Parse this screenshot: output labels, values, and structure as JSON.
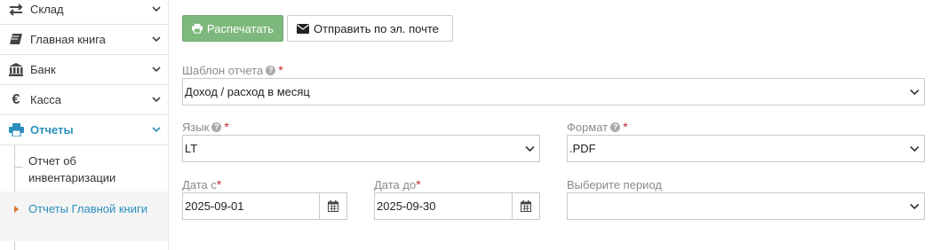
{
  "sidebar": {
    "items": [
      {
        "label": "Склад",
        "icon": "transfer-arrows-icon"
      },
      {
        "label": "Главная книга",
        "icon": "book-icon"
      },
      {
        "label": "Банк",
        "icon": "bank-icon"
      },
      {
        "label": "Касса",
        "icon": "euro-icon"
      },
      {
        "label": "Отчеты",
        "icon": "printer-icon"
      }
    ],
    "submenu": [
      {
        "label": "Отчет об инвентаризации"
      },
      {
        "label": "Отчеты Главной книги"
      }
    ],
    "active_color": "#2a8fbd"
  },
  "toolbar": {
    "print_label": "Распечатать",
    "email_label": "Отправить по эл. почте",
    "print_color": "#7db87d"
  },
  "form": {
    "template": {
      "label": "Шаблон отчета",
      "value": "Доход / расход в месяц"
    },
    "language": {
      "label": "Язык",
      "value": "LT"
    },
    "format": {
      "label": "Формат",
      "value": ".PDF"
    },
    "date_from": {
      "label": "Дата с",
      "value": "2025-09-01"
    },
    "date_to": {
      "label": "Дата до",
      "value": "2025-09-30"
    },
    "period": {
      "label": "Выберите период",
      "value": ""
    },
    "required_mark": "*",
    "help_mark": "?"
  }
}
